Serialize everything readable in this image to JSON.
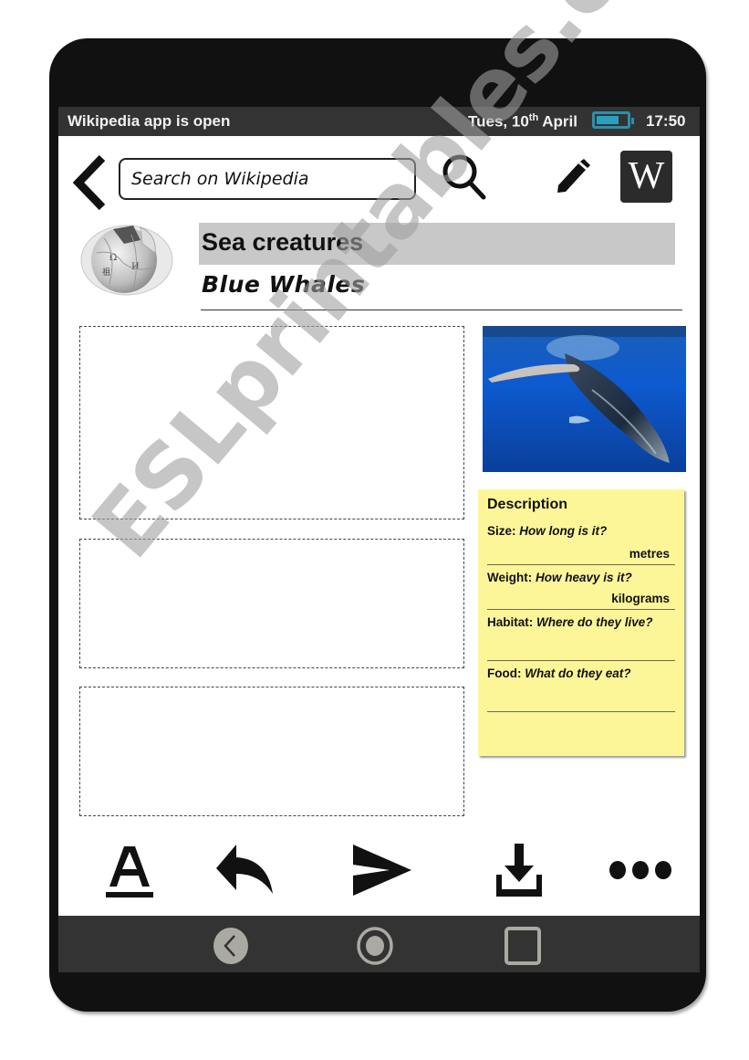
{
  "status_bar": {
    "app_status": "Wikipedia app is open",
    "date_prefix": "Tues, 10",
    "date_suffix": "th",
    "date_month": "April",
    "battery_level": 0.75,
    "time": "17:50"
  },
  "header": {
    "search_placeholder": "Search on Wikipedia",
    "wiki_logo_letter": "W"
  },
  "article": {
    "category": "Sea creatures",
    "title": "Blue  Whales",
    "image_alt": "Humpback whale swimming underwater"
  },
  "description": {
    "heading": "Description",
    "rows": [
      {
        "label": "Size: ",
        "question": "How long is it?",
        "unit": "metres"
      },
      {
        "label": "Weight: ",
        "question": "How heavy is it?",
        "unit": "kilograms"
      },
      {
        "label": "Habitat: ",
        "question": "Where do they  live?",
        "unit": ""
      },
      {
        "label": "Food: ",
        "question": "What do they eat?",
        "unit": ""
      }
    ]
  },
  "watermark": "ESLprintables.com",
  "colors": {
    "device_frame": "#111111",
    "status_bar": "#333333",
    "battery": "#2a8fae",
    "category_bar": "#c8c8c8",
    "description_card": "#fdf699",
    "nav_icons": "#aaa9a2"
  }
}
